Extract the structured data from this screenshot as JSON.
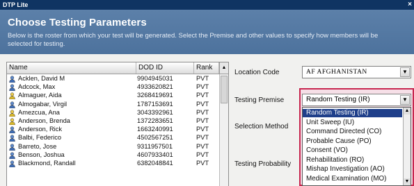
{
  "window": {
    "title": "DTP Lite",
    "close_glyph": "×"
  },
  "header": {
    "title": "Choose Testing Parameters",
    "description": "Below is the roster from which your test will be generated.  Select the Premise and other values to specify how members will be selected for testing."
  },
  "roster": {
    "columns": [
      "Name",
      "DOD ID",
      "Rank"
    ],
    "rows": [
      {
        "name": "Acklen, David M",
        "dod_id": "9904945031",
        "rank": "PVT",
        "icon": "person-blue-icon"
      },
      {
        "name": "Adcock, Max",
        "dod_id": "4933620821",
        "rank": "PVT",
        "icon": "person-blue-icon"
      },
      {
        "name": "Almaguer, Aida",
        "dod_id": "3268419691",
        "rank": "PVT",
        "icon": "person-yellow-icon"
      },
      {
        "name": "Almogabar, Virgil",
        "dod_id": "1787153691",
        "rank": "PVT",
        "icon": "person-blue-icon"
      },
      {
        "name": "Amezcua, Ana",
        "dod_id": "3043392961",
        "rank": "PVT",
        "icon": "person-yellow-icon"
      },
      {
        "name": "Anderson, Brenda",
        "dod_id": "1372283651",
        "rank": "PVT",
        "icon": "person-yellow-icon"
      },
      {
        "name": "Anderson, Rick",
        "dod_id": "1663240991",
        "rank": "PVT",
        "icon": "person-blue-icon"
      },
      {
        "name": "Balbi, Federico",
        "dod_id": "4502567251",
        "rank": "PVT",
        "icon": "person-blue-icon"
      },
      {
        "name": "Barreto, Jose",
        "dod_id": "9311957501",
        "rank": "PVT",
        "icon": "person-blue-icon"
      },
      {
        "name": "Benson, Joshua",
        "dod_id": "4607933401",
        "rank": "PVT",
        "icon": "person-blue-icon"
      },
      {
        "name": "Blackmond, Randall",
        "dod_id": "6382048841",
        "rank": "PVT",
        "icon": "person-blue-icon"
      }
    ]
  },
  "form": {
    "location_code": {
      "label": "Location Code",
      "value": "AF AFGHANISTAN"
    },
    "testing_premise": {
      "label": "Testing Premise",
      "value": "Random Testing (IR)"
    },
    "selection_method": {
      "label": "Selection Method"
    },
    "testing_probability": {
      "label": "Testing Probability"
    }
  },
  "premise_options": [
    "Random Testing (IR)",
    "Unit Sweep (IU)",
    "Command Directed (CO)",
    "Probable Cause (PO)",
    "Consent (VO)",
    "Rehabilitation (RO)",
    "Mishap Investigation (AO)",
    "Medical Examination (MO)"
  ],
  "colors": {
    "title_bar": "#0f3462",
    "header": "#5077a2",
    "selection": "#1f3f8a",
    "highlight_border": "#c7254e"
  }
}
